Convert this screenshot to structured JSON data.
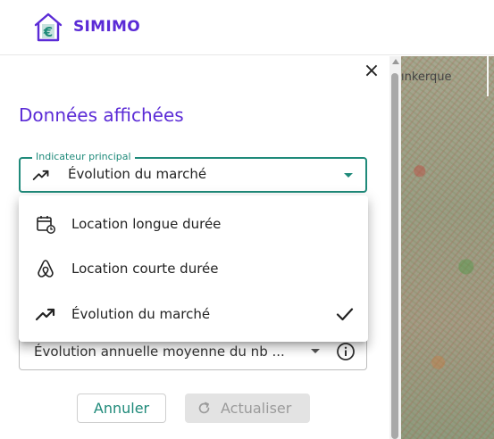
{
  "app": {
    "brand": "SIMIMO",
    "logo_symbol": "€",
    "accent_color": "#5b2bd6",
    "teal_color": "#1f8a7a"
  },
  "map": {
    "visible_label": "ınkerque"
  },
  "panel": {
    "title": "Données affichées",
    "close_icon": "×",
    "indicator": {
      "legend": "Indicateur principal",
      "value": "Évolution du marché",
      "icon": "trending-up-icon"
    },
    "dropdown": {
      "options": [
        {
          "label": "Location longue durée",
          "icon": "calendar-refresh-icon",
          "selected": false
        },
        {
          "label": "Location courte durée",
          "icon": "airbnb-icon",
          "selected": false
        },
        {
          "label": "Évolution du marché",
          "icon": "trending-up-icon",
          "selected": true
        }
      ]
    },
    "secondary": {
      "value": "Évolution annuelle moyenne du nb ...",
      "icon": "info-icon"
    },
    "actions": {
      "cancel_label": "Annuler",
      "refresh_label": "Actualiser",
      "refresh_icon": "refresh-icon"
    }
  }
}
